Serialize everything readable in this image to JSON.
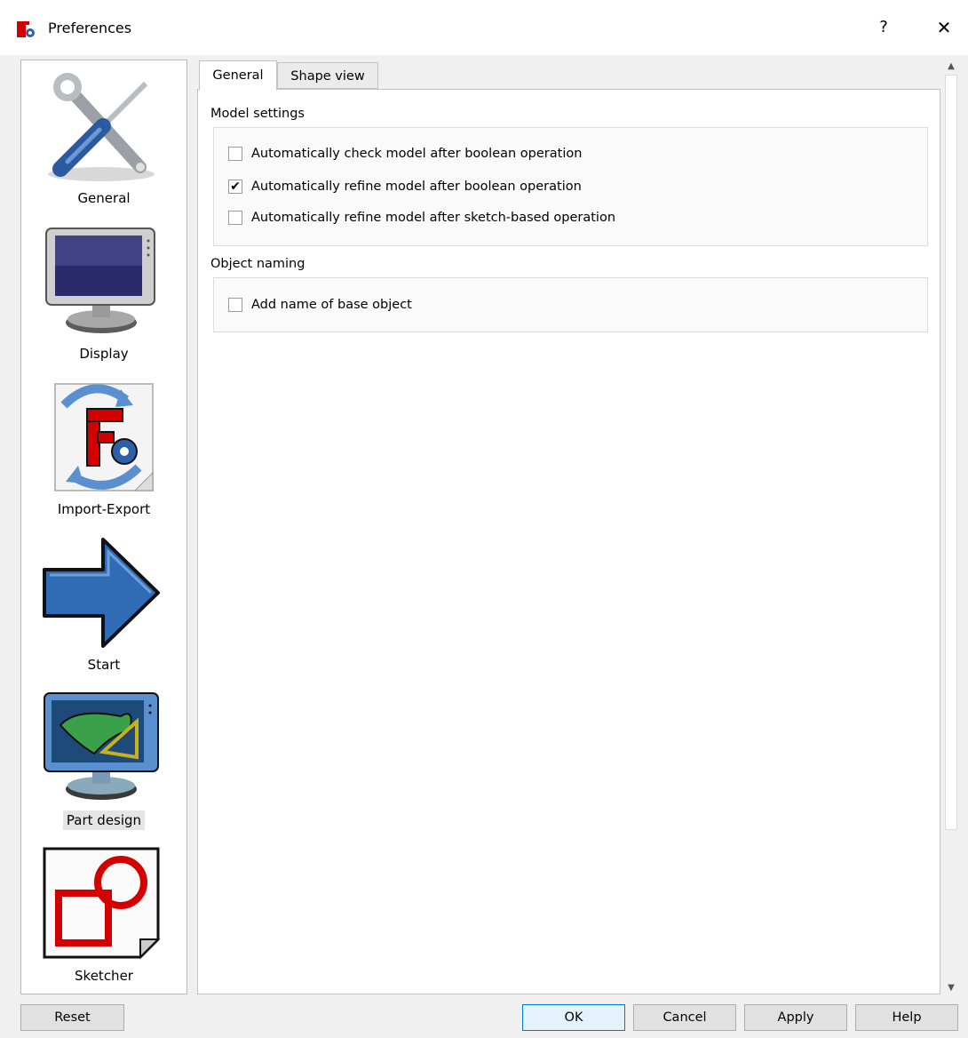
{
  "window": {
    "title": "Preferences",
    "help_glyph": "?",
    "close_glyph": "✕"
  },
  "sidebar": {
    "items": [
      {
        "label": "General",
        "icon": "wrench-screwdriver-icon"
      },
      {
        "label": "Display",
        "icon": "monitor-icon"
      },
      {
        "label": "Import-Export",
        "icon": "import-export-icon"
      },
      {
        "label": "Start",
        "icon": "arrow-right-icon"
      },
      {
        "label": "Part design",
        "icon": "part-design-icon",
        "selected": true
      },
      {
        "label": "Sketcher",
        "icon": "sketcher-icon"
      }
    ]
  },
  "tabs": [
    {
      "label": "General",
      "active": true
    },
    {
      "label": "Shape view",
      "active": false
    }
  ],
  "groups": {
    "model_settings": {
      "title": "Model settings",
      "options": [
        {
          "label": "Automatically check model after boolean operation",
          "checked": false
        },
        {
          "label": "Automatically refine model after boolean operation",
          "checked": true
        },
        {
          "label": "Automatically refine model after sketch-based operation",
          "checked": false
        }
      ]
    },
    "object_naming": {
      "title": "Object naming",
      "options": [
        {
          "label": "Add name of base object",
          "checked": false
        }
      ]
    }
  },
  "check_glyph": "✔",
  "buttons": {
    "reset": "Reset",
    "ok": "OK",
    "cancel": "Cancel",
    "apply": "Apply",
    "help": "Help"
  },
  "colors": {
    "accent": "#0078d7",
    "freecad_red": "#d40000",
    "freecad_blue": "#2f5fa8"
  }
}
